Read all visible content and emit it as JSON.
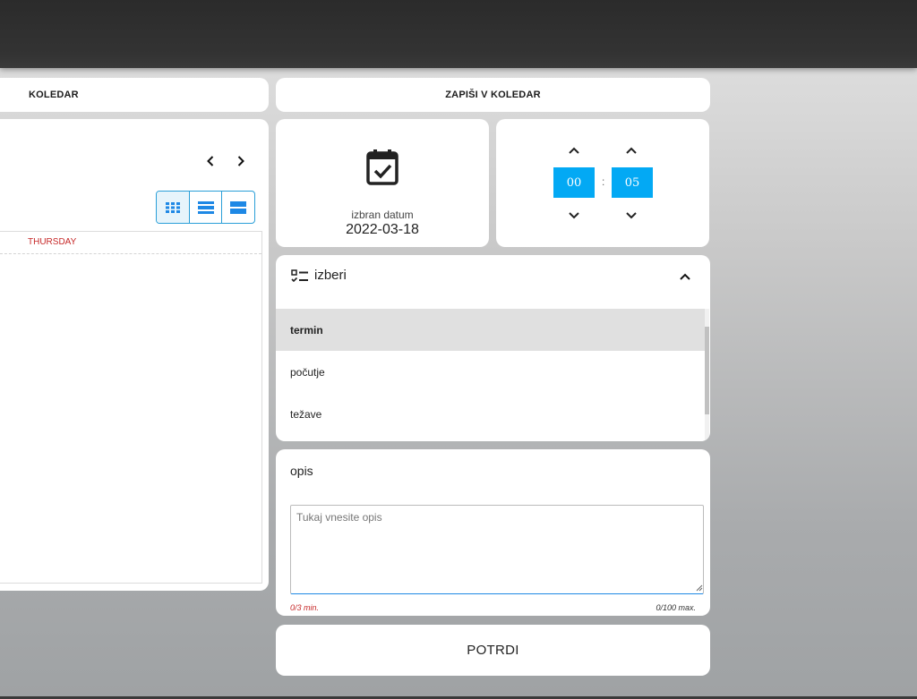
{
  "tabs": {
    "calendar": "KOLEDAR",
    "write": "ZAPIŠI V KOLEDAR"
  },
  "calendar": {
    "day_header": "THURSDAY",
    "views": [
      "month-view",
      "week-view",
      "day-view"
    ],
    "active_view": "month-view"
  },
  "date": {
    "label": "izbran datum",
    "value": "2022-03-18"
  },
  "time": {
    "hours": "00",
    "minutes": "05",
    "separator": ":"
  },
  "select": {
    "title": "izberi",
    "items": [
      {
        "label": "termin",
        "selected": true
      },
      {
        "label": "počutje",
        "selected": false
      },
      {
        "label": "težave",
        "selected": false
      }
    ]
  },
  "description": {
    "title": "opis",
    "placeholder": "Tukaj vnesite opis",
    "min_counter": "0/3 min.",
    "max_counter": "0/100 max."
  },
  "confirm": {
    "label": "POTRDI"
  },
  "colors": {
    "accent": "#03a9f4",
    "border_accent": "#2a9fd8",
    "weekday_red": "#c62828",
    "topbar": "#333333"
  }
}
